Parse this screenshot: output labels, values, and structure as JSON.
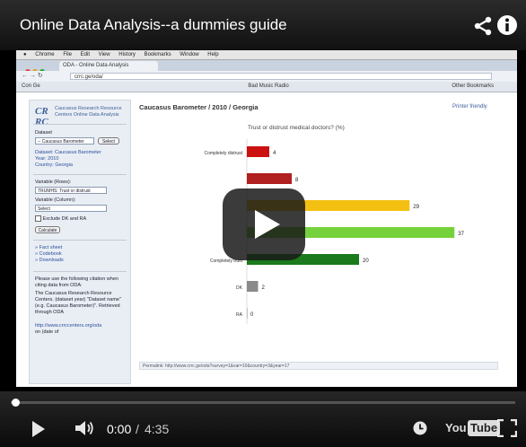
{
  "player": {
    "title": "Online Data Analysis--a dummies guide",
    "time_current": "0:00",
    "time_separator": "/",
    "time_duration": "4:35",
    "progress_fraction": 0,
    "logo_you": "You",
    "logo_tube": "Tube"
  },
  "browser": {
    "menubar": [
      "Chrome",
      "File",
      "Edit",
      "View",
      "History",
      "Bookmarks",
      "Window",
      "Help"
    ],
    "tab_label": "ODA - Online Data Analysis",
    "url": "crrc.ge/oda/",
    "bookmarks": [
      "Con Ge",
      "Bad Music Radio",
      "Other Bookmarks"
    ]
  },
  "sidebar": {
    "org_logo": "CR RC",
    "org_name": "Caucasus Research Resource Centers Online Data Analysis",
    "dataset_label": "Dataset",
    "dataset_select": "-- Caucasus Barometer",
    "select_button": "Select",
    "dataset_line": "Dataset: Caucasus Barometer",
    "year_line": "Year: 2010",
    "country_line": "Country: Georgia",
    "row_label": "Variable (Rows):",
    "row_select": "TRUMHS: Trust or distrust",
    "col_label": "Variable (Column):",
    "col_select": "Select",
    "exclude_label": "Exclude DK and RA",
    "calculate_button": "Calculate",
    "links": [
      "Fact sheet",
      "Codebook",
      "Downloads"
    ],
    "cite_text_1": "Please use the following citation when citing data from ODA:",
    "cite_text_2": "The Caucasus Research Resource Centers. (dataset year) \"Dataset name\" (e.g. Caucasus Barometer)\". Retrieved through ODA",
    "cite_link": "http://www.crrccenters.org/oda",
    "cite_text_3": "on (date of"
  },
  "main": {
    "heading": "Caucasus Barometer / 2010 / Georgia",
    "printer_link": "Printer friendly",
    "permalink": "Permalink: http://www.crrc.ge/oda?survey=1&var=10&country=3&year=17"
  },
  "chart_data": {
    "type": "bar",
    "orientation": "horizontal",
    "title": "Trust or distrust medical doctors? (%)",
    "categories": [
      "Completely distrust",
      "",
      "",
      "",
      "Completely trust",
      "DK",
      "RA"
    ],
    "values": [
      4,
      8,
      29,
      37,
      20,
      2,
      0
    ],
    "colors": [
      "#cc1111",
      "#b02020",
      "#f3c012",
      "#76d23c",
      "#1b7a1b",
      "#8a8a8a",
      "#8a8a8a"
    ],
    "xlim": [
      0,
      40
    ]
  },
  "colors": {
    "bar_red": "#cc1111",
    "bar_yellow": "#f3c012",
    "bar_lightgreen": "#76d23c",
    "bar_darkgreen": "#1b7a1b",
    "bar_gray": "#8a8a8a",
    "accent_link": "#2c4f9e"
  }
}
